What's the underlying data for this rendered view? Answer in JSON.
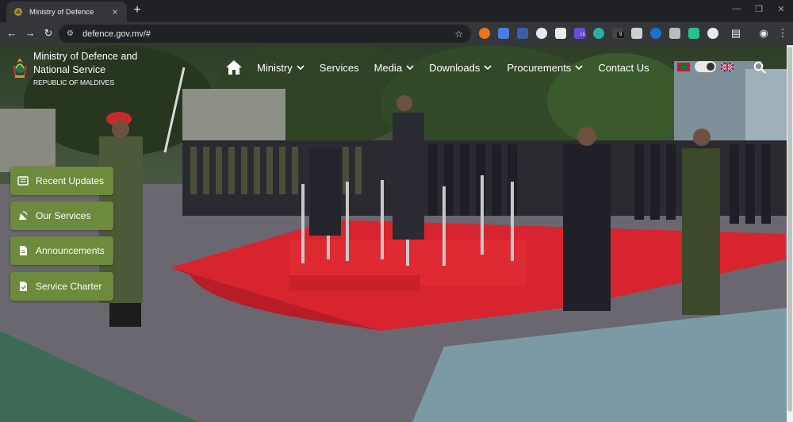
{
  "browser": {
    "tab": {
      "title": "Ministry of Defence",
      "close": "×"
    },
    "new_tab": "+",
    "window_controls": {
      "minimize": "—",
      "maximize": "❐",
      "close": "✕"
    },
    "nav": {
      "back": "←",
      "forward": "→",
      "reload": "↻"
    },
    "address": {
      "url": "defence.gov.mv/#",
      "star": "☆"
    },
    "extensions": [
      {
        "name": "avast-extension-icon",
        "color": "#e8761a"
      },
      {
        "name": "translate-extension-icon",
        "color": "#4a7fe0"
      },
      {
        "name": "shield-extension-icon",
        "color": "#3a5fa8"
      },
      {
        "name": "grid-extension-icon",
        "color": "#e8eaed"
      },
      {
        "name": "clipboard-extension-icon",
        "color": "#e8eaed"
      },
      {
        "name": "puzzle-badge-extension-icon",
        "color": "#6b4bd8",
        "badge": "16",
        "badge_color": "#5b3fc4"
      },
      {
        "name": "rainbow-extension-icon",
        "color": "#2bb0a0"
      },
      {
        "name": "dark-badge-extension-icon",
        "color": "#444",
        "badge": "9",
        "badge_color": "#1a1a1a"
      },
      {
        "name": "gear-extension-icon",
        "color": "#d0d0d0"
      },
      {
        "name": "square-extension-icon",
        "color": "#1d6fd0"
      },
      {
        "name": "globe-extension-icon",
        "color": "#b9bcbf"
      },
      {
        "name": "bolt-extension-icon",
        "color": "#29c08a"
      },
      {
        "name": "extensions-puzzle-icon",
        "color": "#e8eaed"
      }
    ],
    "right_icons": {
      "sidepanel": "▤",
      "profile": "◉",
      "menu": "⋮"
    }
  },
  "site": {
    "org_name": "Ministry of Defence and National Service",
    "country": "REPUBLIC OF MALDIVES",
    "nav": [
      {
        "label": "Ministry",
        "dropdown": true
      },
      {
        "label": "Services",
        "dropdown": false
      },
      {
        "label": "Media",
        "dropdown": true
      },
      {
        "label": "Downloads",
        "dropdown": true
      },
      {
        "label": "Procurements",
        "dropdown": true
      },
      {
        "label": "Contact Us",
        "dropdown": false
      }
    ],
    "side_buttons": [
      {
        "label": "Recent Updates",
        "icon": "newspaper-icon"
      },
      {
        "label": "Our Services",
        "icon": "satellite-dish-icon"
      },
      {
        "label": "Announcements",
        "icon": "document-icon"
      },
      {
        "label": "Service Charter",
        "icon": "file-check-icon"
      }
    ],
    "colors": {
      "accent_green": "#6d8a3d",
      "carpet_red": "#d8242f"
    }
  }
}
